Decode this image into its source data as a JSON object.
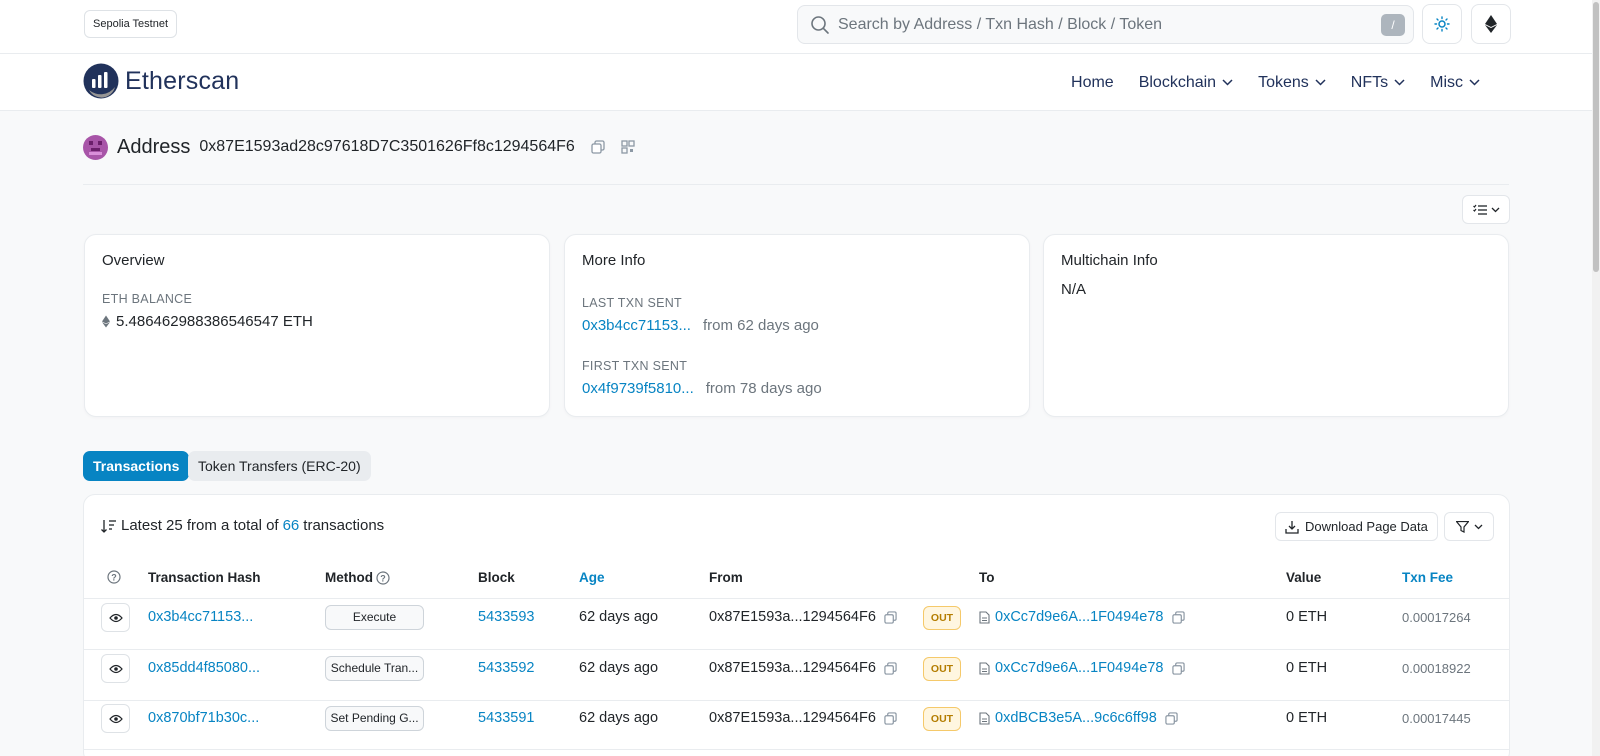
{
  "network": {
    "label": "Sepolia Testnet"
  },
  "search": {
    "placeholder": "Search by Address / Txn Hash / Block / Token",
    "shortcut": "/"
  },
  "brand": {
    "name": "Etherscan"
  },
  "nav": {
    "items": [
      {
        "label": "Home",
        "has_dropdown": false
      },
      {
        "label": "Blockchain",
        "has_dropdown": true
      },
      {
        "label": "Tokens",
        "has_dropdown": true
      },
      {
        "label": "NFTs",
        "has_dropdown": true
      },
      {
        "label": "Misc",
        "has_dropdown": true
      }
    ]
  },
  "address": {
    "title": "Address",
    "hash": "0x87E1593ad28c97618D7C3501626Ff8c1294564F6"
  },
  "overview": {
    "title": "Overview",
    "balance_label": "ETH BALANCE",
    "balance_value": "5.486462988386546547 ETH"
  },
  "more_info": {
    "title": "More Info",
    "last_label": "LAST TXN SENT",
    "last_hash": "0x3b4cc71153...",
    "last_age": "from 62 days ago",
    "first_label": "FIRST TXN SENT",
    "first_hash": "0x4f9739f5810...",
    "first_age": "from 78 days ago"
  },
  "multichain": {
    "title": "Multichain Info",
    "value": "N/A"
  },
  "tabs": {
    "transactions": "Transactions",
    "token_transfers": "Token Transfers (ERC-20)"
  },
  "table": {
    "summary_prefix": "Latest 25 from a total of",
    "summary_count": "66",
    "summary_suffix": "transactions",
    "download_label": "Download Page Data",
    "headers": {
      "hash": "Transaction Hash",
      "method": "Method",
      "block": "Block",
      "age": "Age",
      "from": "From",
      "to": "To",
      "value": "Value",
      "fee": "Txn Fee"
    },
    "rows": [
      {
        "hash": "0x3b4cc71153...",
        "method": "Execute",
        "block": "5433593",
        "age": "62 days ago",
        "from": "0x87E1593a...1294564F6",
        "direction": "OUT",
        "to": "0xCc7d9e6A...1F0494e78",
        "value": "0 ETH",
        "fee": "0.00017264"
      },
      {
        "hash": "0x85dd4f85080...",
        "method": "Schedule Tran...",
        "block": "5433592",
        "age": "62 days ago",
        "from": "0x87E1593a...1294564F6",
        "direction": "OUT",
        "to": "0xCc7d9e6A...1F0494e78",
        "value": "0 ETH",
        "fee": "0.00018922"
      },
      {
        "hash": "0x870bf71b30c...",
        "method": "Set Pending G...",
        "block": "5433591",
        "age": "62 days ago",
        "from": "0x87E1593a...1294564F6",
        "direction": "OUT",
        "to": "0xdBCB3e5A...9c6c6ff98",
        "value": "0 ETH",
        "fee": "0.00017445"
      }
    ]
  },
  "colors": {
    "accent": "#0784c3",
    "brand_dark": "#21325b",
    "out_badge": "#b47d00"
  }
}
